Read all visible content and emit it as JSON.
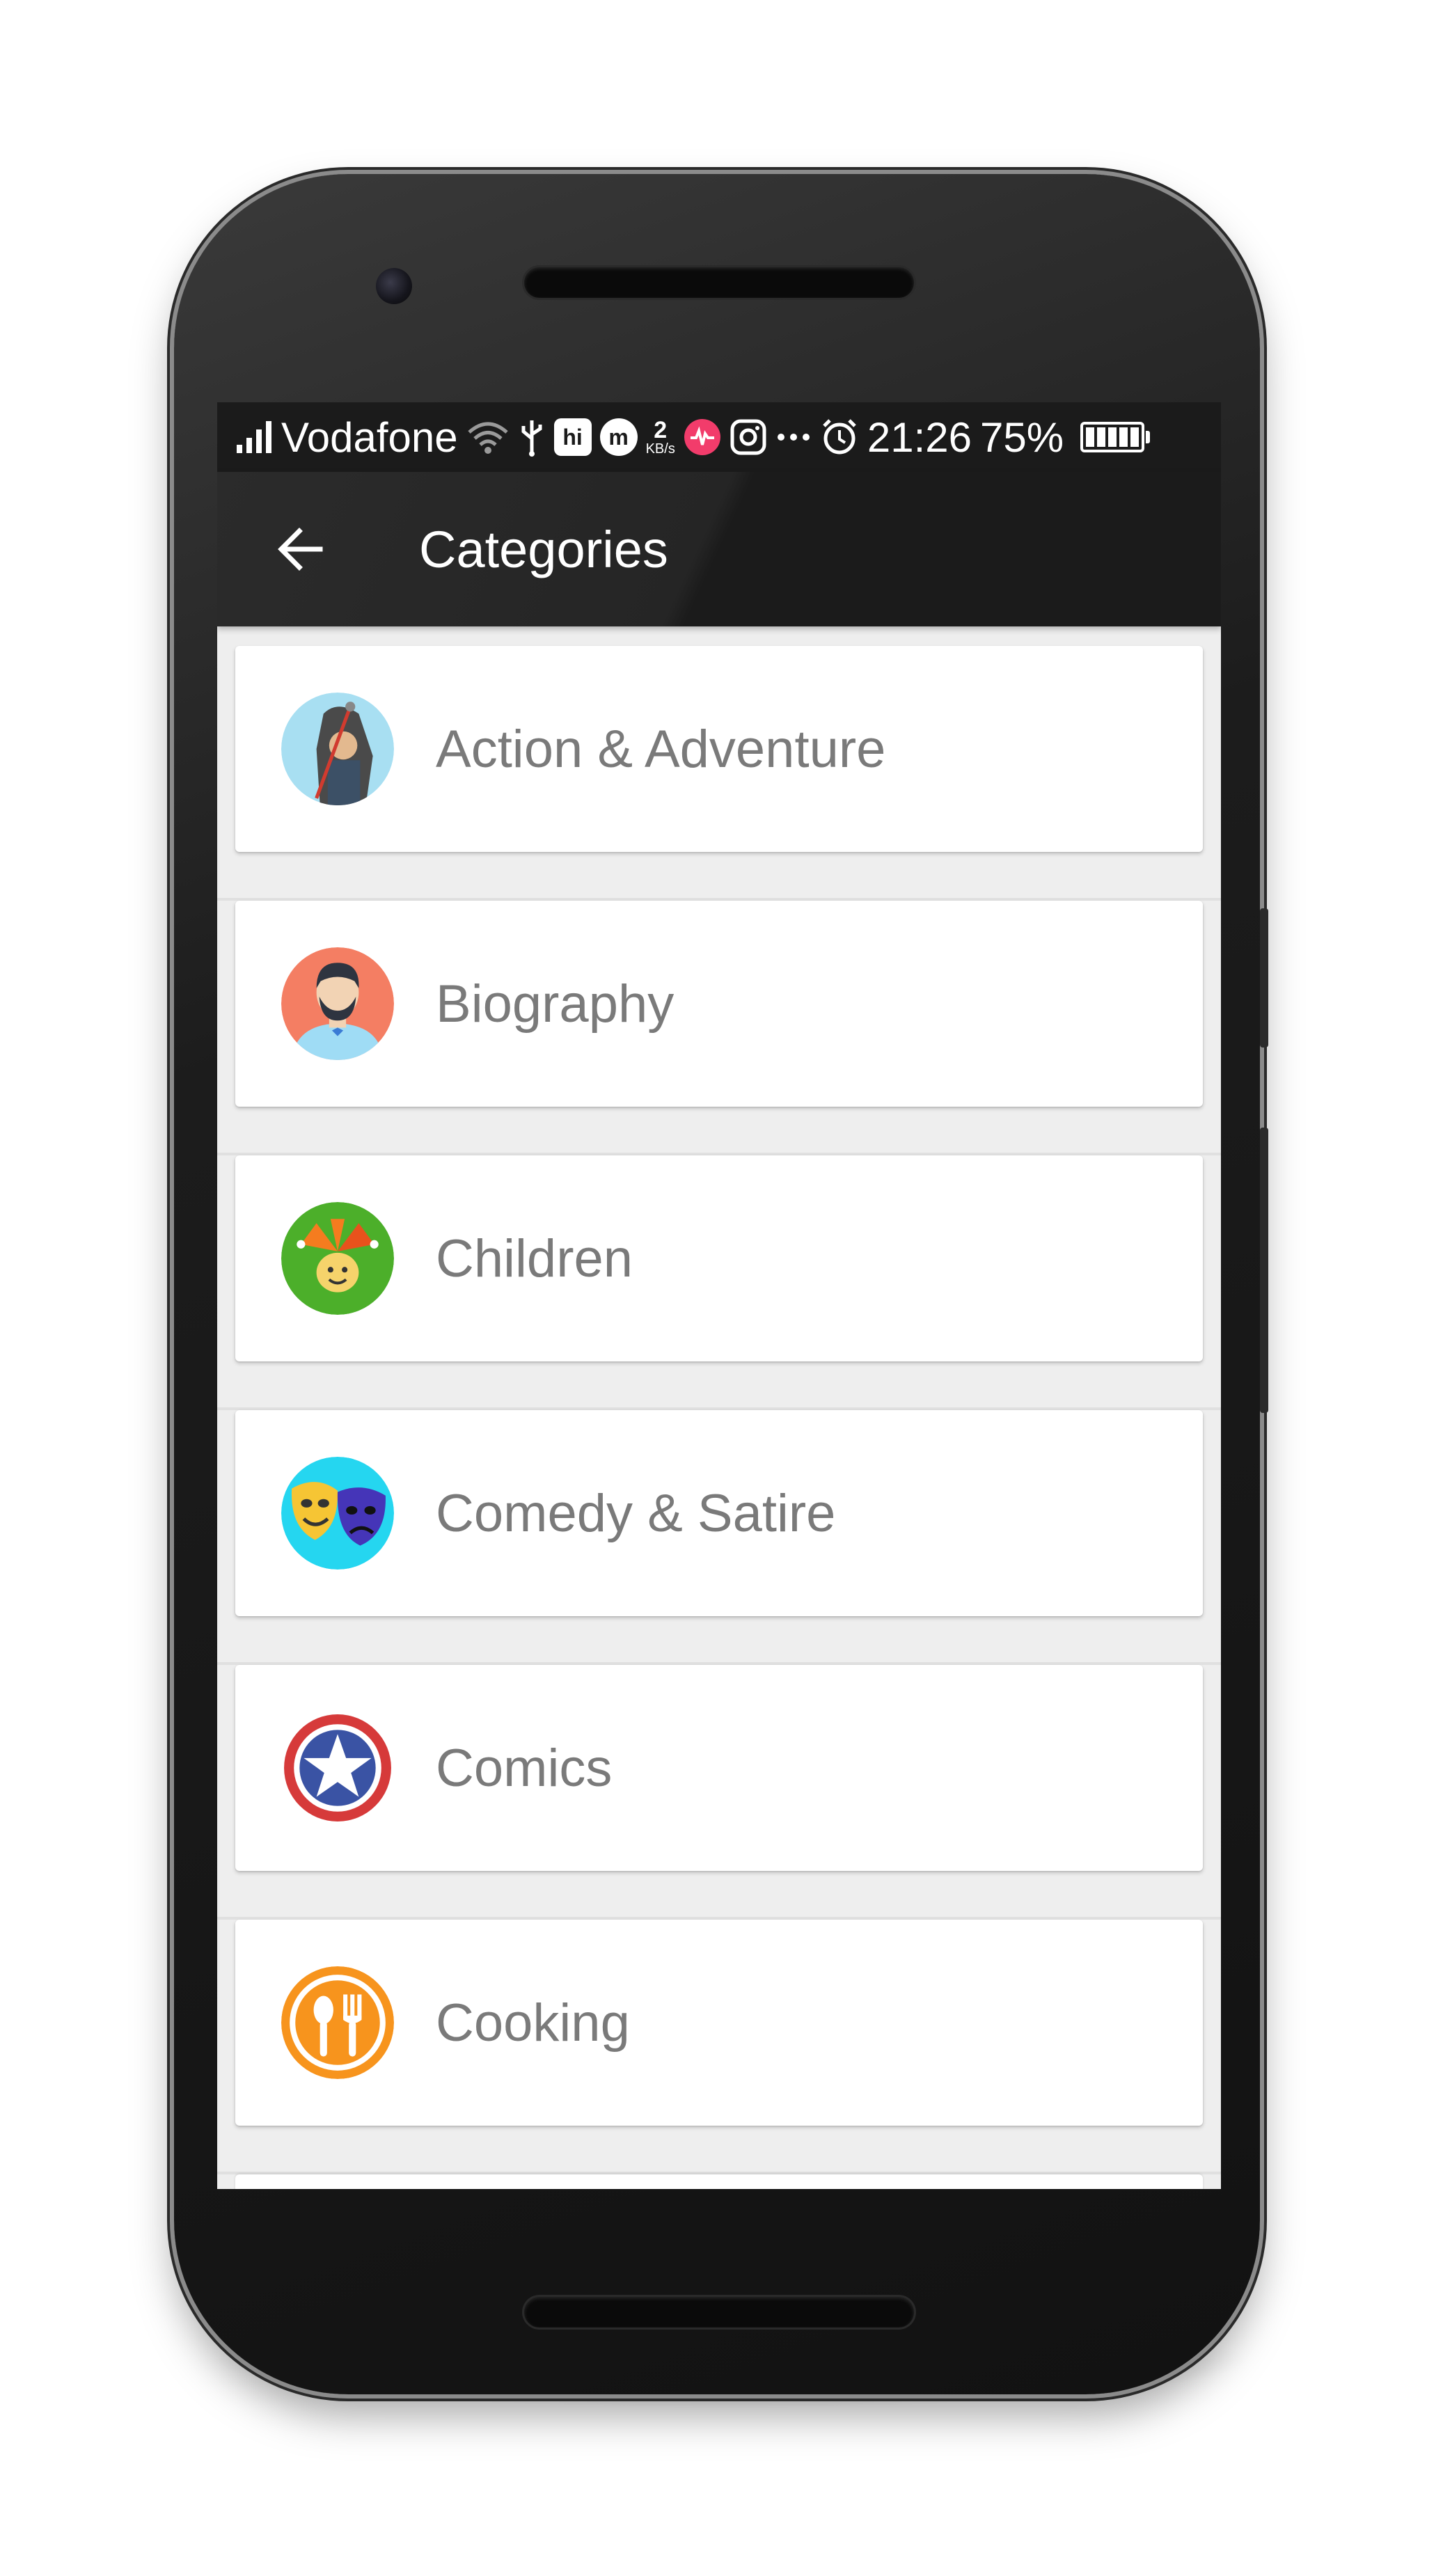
{
  "status_bar": {
    "carrier": "Vodafone",
    "data_rate_value": "2",
    "data_rate_unit": "KB/s",
    "time": "21:26",
    "battery": "75%"
  },
  "app_bar": {
    "title": "Categories"
  },
  "categories": [
    {
      "label": "Action & Adventure",
      "icon": "action-adventure-icon"
    },
    {
      "label": "Biography",
      "icon": "biography-icon"
    },
    {
      "label": "Children",
      "icon": "children-icon"
    },
    {
      "label": "Comedy & Satire",
      "icon": "comedy-satire-icon"
    },
    {
      "label": "Comics",
      "icon": "comics-icon"
    },
    {
      "label": "Cooking",
      "icon": "cooking-icon"
    }
  ],
  "colors": {
    "app_bar": "#1b1b1b",
    "list_background": "#eeeeee",
    "card": "#ffffff",
    "label_text": "#7a7a7a"
  }
}
